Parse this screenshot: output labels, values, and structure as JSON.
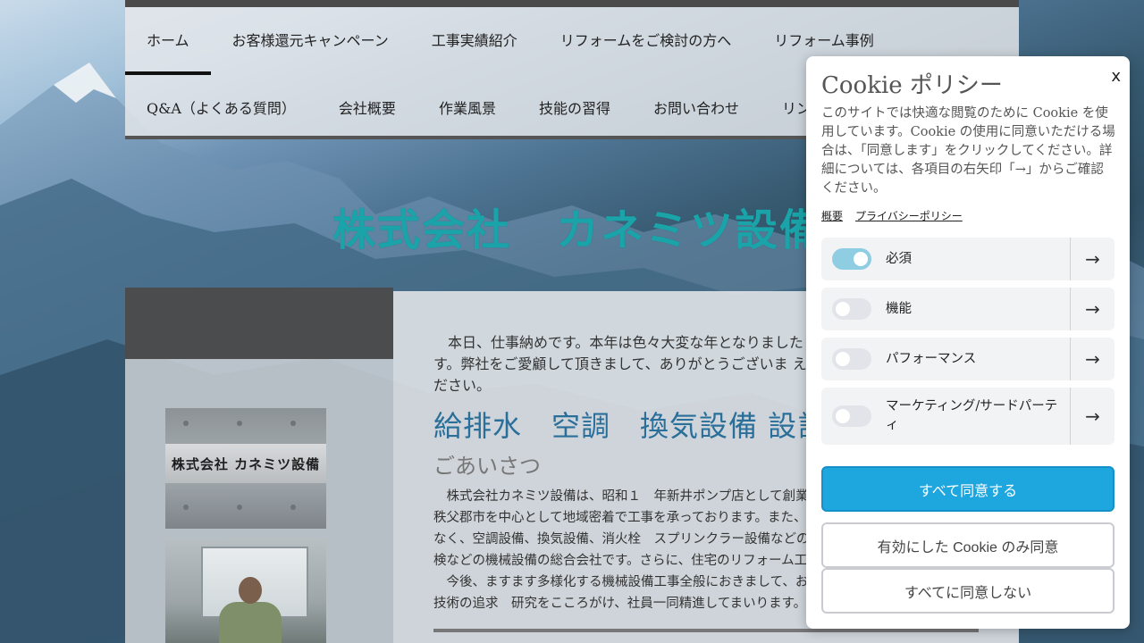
{
  "nav": {
    "row1": [
      "ホーム",
      "お客様還元キャンペーン",
      "工事実績紹介",
      "リフォームをご検討の方へ",
      "リフォーム事例"
    ],
    "row2": [
      "Q&A（よくある質問）",
      "会社概要",
      "作業風景",
      "技能の習得",
      "お問い合わせ",
      "リン"
    ]
  },
  "site_title": "株式会社　カネミツ設備",
  "photo_sign": "株式会社 カネミツ設備",
  "main": {
    "intro": "　本日、仕事納めです。本年は色々大変な年となりました です。弊社をご愛顧して頂きまして、ありがとうございま えください。",
    "heading": "給排水　空調　換気設備  設計",
    "subheading": "ごあいさつ",
    "body": "　株式会社カネミツ設備は、昭和１　年新井ポンプ店として創業以 秩父郡市を中心として地域密着で工事を承っております。また、弊 なく、空調設備、換気設備、消火栓　スプリンクラー設備などの防 検などの機械設備の総合会社です。さらに、住宅のリフォーム工事 　今後、ますます多様化する機械設備工事全般におきまして、お客 技術の追求　研究をこころがけ、社員一同精進してまいります。"
  },
  "cookie": {
    "close": "x",
    "title": "Cookie ポリシー",
    "description": "このサイトでは快適な閲覧のために Cookie を使用しています。Cookie の使用に同意いただける場合は、「同意します」をクリックしてください。詳細については、各項目の右矢印「→」からご確認ください。",
    "link_overview": "概要",
    "link_privacy": "プライバシーポリシー",
    "categories": [
      {
        "label": "必須",
        "enabled": true
      },
      {
        "label": "機能",
        "enabled": false
      },
      {
        "label": "パフォーマンス",
        "enabled": false
      },
      {
        "label": "マーケティング/サードパーティ",
        "enabled": false
      }
    ],
    "arrow": "→",
    "accept_all": "すべて同意する",
    "accept_enabled": "有効にした Cookie のみ同意",
    "reject_all": "すべてに同意しない"
  },
  "colors": {
    "accent": "#1ea6df",
    "title_teal": "#1aa3a8",
    "heading_blue": "#2a6f9a",
    "toggle_on": "#8fcde3"
  }
}
